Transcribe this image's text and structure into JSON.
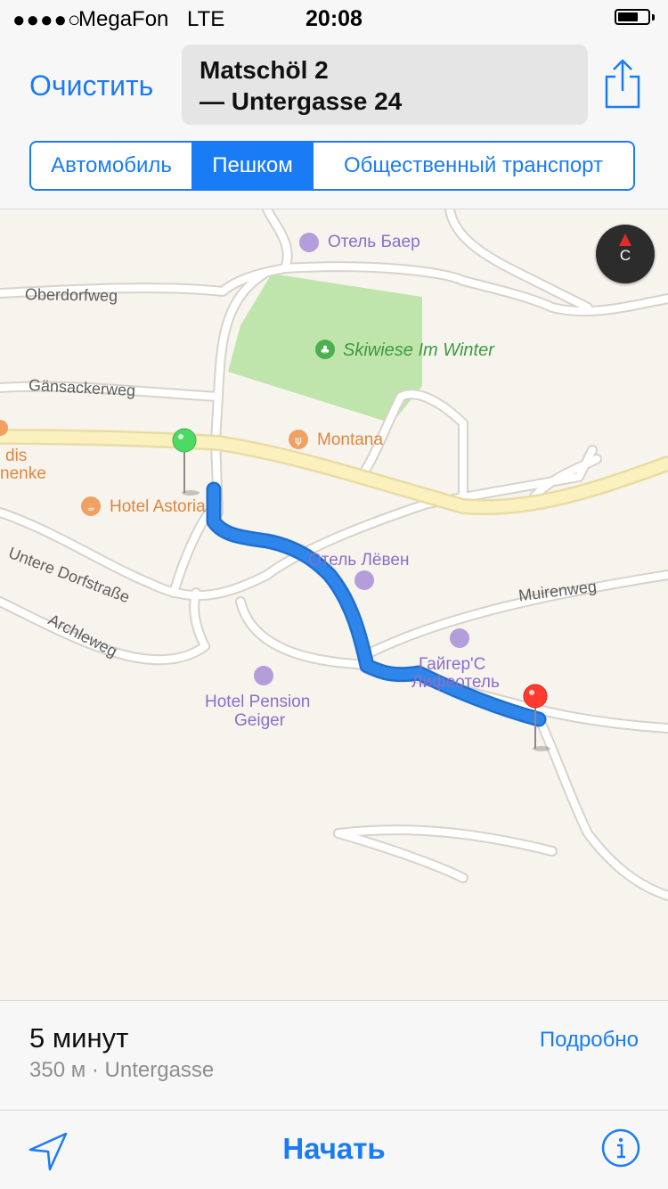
{
  "status_bar": {
    "signal": "●●●●○",
    "carrier": "MegaFon",
    "network": "LTE",
    "time": "20:08"
  },
  "header": {
    "clear_label": "Очистить",
    "route_from": "Matschöl 2",
    "route_to": "— Untergasse 24",
    "share_icon": "share-icon"
  },
  "transport_modes": {
    "items": [
      {
        "label": "Автомобиль",
        "active": false
      },
      {
        "label": "Пешком",
        "active": true
      },
      {
        "label": "Общественный транспорт",
        "active": false
      }
    ]
  },
  "map": {
    "compass_letter": "С",
    "streets": [
      "Oberdorfweg",
      "Gänsackerweg",
      "Untere Dorfstraße",
      "Archleweg",
      "Muirenweg"
    ],
    "pois": {
      "hotel_baer": "Отель Баер",
      "skiwiese": "Skiwiese Im Winter",
      "montana": "Montana",
      "hotel_astoria": "Hotel Astoria",
      "hotel_leven": "Отель Лёвен",
      "geiger_line1": "Гайгер'С",
      "geiger_line2": "Лифеотель",
      "pension_line1": "Hotel Pension",
      "pension_line2": "Geiger",
      "cut_line1": "dis",
      "cut_line2": "nenke"
    },
    "route_color": "#2f86ea",
    "start_pin_color": "#4cd964",
    "end_pin_color": "#ff3b30"
  },
  "route_info": {
    "eta": "5 минут",
    "distance": "350 м · Untergasse",
    "details_label": "Подробно"
  },
  "toolbar": {
    "start_label": "Начать",
    "location_icon": "location-arrow-icon",
    "info_icon": "info-icon"
  }
}
